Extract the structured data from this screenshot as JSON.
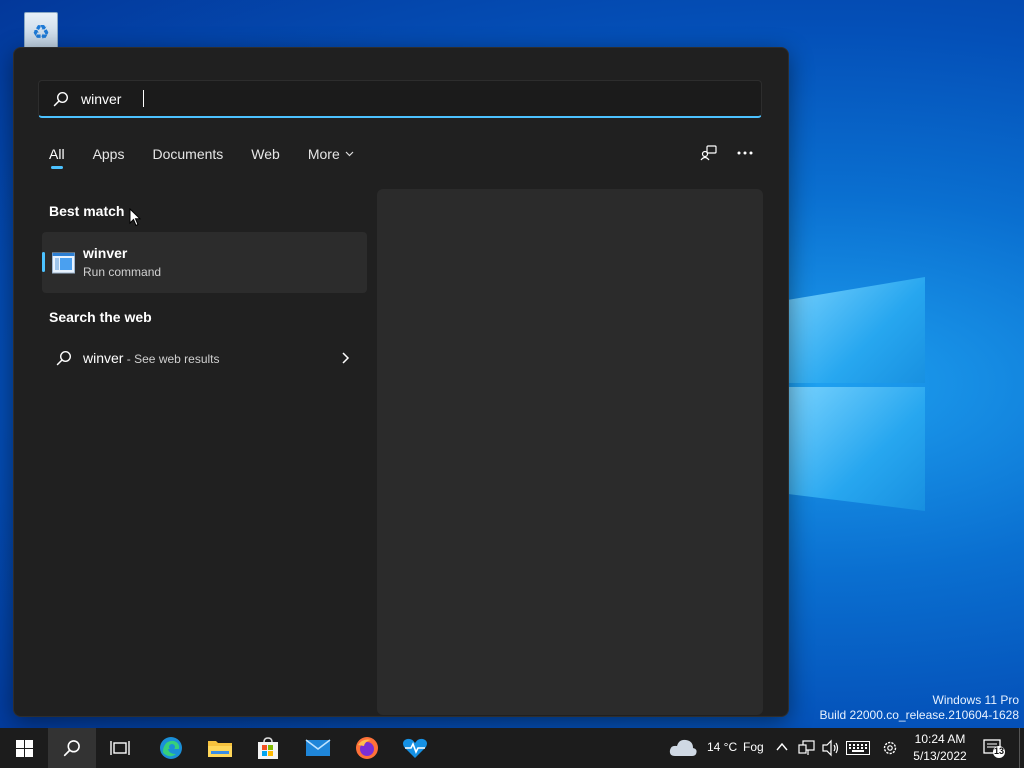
{
  "search": {
    "query": "winver"
  },
  "tabs": [
    {
      "label": "All",
      "active": true
    },
    {
      "label": "Apps"
    },
    {
      "label": "Documents"
    },
    {
      "label": "Web"
    },
    {
      "label": "More"
    }
  ],
  "best_match": {
    "title": "Best match",
    "item_name": "winver",
    "item_type": "Run command"
  },
  "search_web": {
    "title": "Search the web",
    "query": "winver",
    "suffix": " - See web results"
  },
  "desktop": {
    "watermark_line1": "Windows 11 Pro",
    "watermark_line2": "Build 22000.co_release.210604-1628"
  },
  "taskbar": {
    "weather_temp": "14 °C",
    "weather_condition": "Fog",
    "time": "10:24 AM",
    "date": "5/13/2022",
    "notification_count": "13"
  },
  "colors": {
    "accent": "#4cc2ff",
    "panel_bg": "#202020",
    "taskbar_bg": "#1c1c1c"
  },
  "icons": [
    "recycle-bin-icon",
    "search-icon",
    "share-devices-icon",
    "more-options-icon",
    "winver-app-icon",
    "chevron-right-icon",
    "windows-start-icon",
    "task-view-icon",
    "edge-icon",
    "file-explorer-icon",
    "store-icon",
    "mail-icon",
    "firefox-icon",
    "health-icon",
    "weather-cloud-icon",
    "tray-chevron-icon",
    "network-icon",
    "volume-icon",
    "keyboard-icon",
    "settings-gear-icon",
    "notification-icon"
  ]
}
